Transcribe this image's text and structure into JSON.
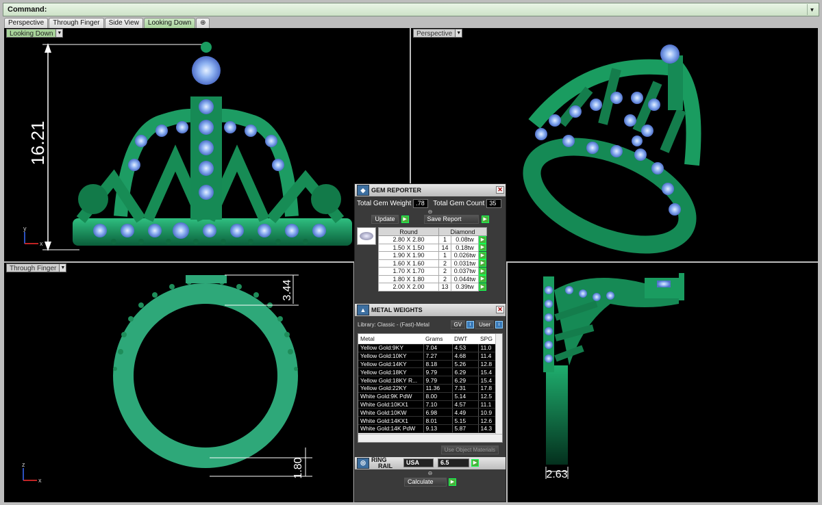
{
  "command": {
    "label": "Command:",
    "value": ""
  },
  "tabs": [
    "Perspective",
    "Through Finger",
    "Side View",
    "Looking Down"
  ],
  "viewports": {
    "top_left": {
      "label": "Looking Down",
      "dimension": "16.21"
    },
    "top_right": {
      "label": "Perspective"
    },
    "bottom_left": {
      "label": "Through Finger",
      "dimension_top": "3.44",
      "dimension_bottom": "1.80"
    },
    "bottom_right": {
      "dimension": "2.63"
    }
  },
  "axes": {
    "x": "x",
    "y": "y",
    "z": "z"
  },
  "gem_reporter": {
    "title": "GEM REPORTER",
    "total_weight_label": "Total Gem Weight",
    "total_weight": ".78",
    "total_count_label": "Total Gem Count",
    "total_count": "35",
    "update_label": "Update",
    "save_report_label": "Save Report",
    "shape": "Round",
    "material": "Diamond",
    "rows": [
      {
        "size": "2.80 X 2.80",
        "count": "1",
        "weight": "0.08tw"
      },
      {
        "size": "1.50 X 1.50",
        "count": "14",
        "weight": "0.18tw"
      },
      {
        "size": "1.90 X 1.90",
        "count": "1",
        "weight": "0.026tw"
      },
      {
        "size": "1.60 X 1.60",
        "count": "2",
        "weight": "0.031tw"
      },
      {
        "size": "1.70 X 1.70",
        "count": "2",
        "weight": "0.037tw"
      },
      {
        "size": "1.80 X 1.80",
        "count": "2",
        "weight": "0.044tw"
      },
      {
        "size": "2.00 X 2.00",
        "count": "13",
        "weight": "0.39tw"
      }
    ]
  },
  "metal_weights": {
    "title": "METAL WEIGHTS",
    "library": "Library: Classic - (Fast)-Metal",
    "gv_label": "GV",
    "user_label": "User",
    "columns": [
      "Metal",
      "Grams",
      "DWT",
      "SPG"
    ],
    "rows": [
      [
        "Yellow Gold:9KY",
        "7.04",
        "4.53",
        "11.0"
      ],
      [
        "Yellow Gold:10KY",
        "7.27",
        "4.68",
        "11.4"
      ],
      [
        "Yellow Gold:14KY",
        "8.18",
        "5.26",
        "12.8"
      ],
      [
        "Yellow Gold:18KY",
        "9.79",
        "6.29",
        "15.4"
      ],
      [
        "Yellow Gold:18KY R...",
        "9.79",
        "6.29",
        "15.4"
      ],
      [
        "Yellow Gold:22KY",
        "11.36",
        "7.31",
        "17.8"
      ],
      [
        "White Gold:9K PdW",
        "8.00",
        "5.14",
        "12.5"
      ],
      [
        "White Gold:10KX1",
        "7.10",
        "4.57",
        "11.1"
      ],
      [
        "White Gold:10KW",
        "6.98",
        "4.49",
        "10.9"
      ],
      [
        "White Gold:14KX1",
        "8.01",
        "5.15",
        "12.6"
      ],
      [
        "White Gold:14K PdW",
        "9.13",
        "5.87",
        "14.3"
      ]
    ],
    "use_object_materials": "Use Object Materials"
  },
  "ring_rail": {
    "title_line1": "RING",
    "title_line2": "RAIL",
    "standard": "USA",
    "size": "6.5",
    "calculate_label": "Calculate"
  }
}
